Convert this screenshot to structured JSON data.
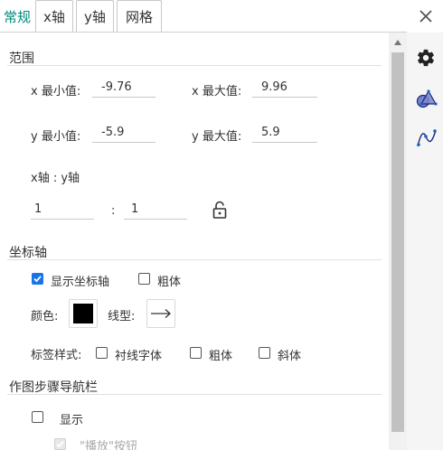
{
  "tabs": [
    {
      "label": "常规",
      "active": true
    },
    {
      "label": "x轴",
      "active": false
    },
    {
      "label": "y轴",
      "active": false
    },
    {
      "label": "网格",
      "active": false
    }
  ],
  "icons": {
    "close": "close-icon",
    "side": [
      "gear-icon",
      "graphics-shapes-icon",
      "function-graph-icon"
    ]
  },
  "range": {
    "title": "范围",
    "xmin_label": "x 最小值:",
    "xmin_value": "-9.76",
    "xmax_label": "x 最大值:",
    "xmax_value": "9.96",
    "ymin_label": "y 最小值:",
    "ymin_value": "-5.9",
    "ymax_label": "y 最大值:",
    "ymax_value": "5.9",
    "ratio_label": "x轴 : y轴",
    "ratio_x": "1",
    "ratio_sep": ":",
    "ratio_y": "1"
  },
  "axes": {
    "title": "坐标轴",
    "show_axes_label": "显示坐标轴",
    "show_axes_checked": true,
    "bold_label": "粗体",
    "bold_checked": false,
    "color_label": "颜色:",
    "color_value": "#000000",
    "linestyle_label": "线型:",
    "label_style_label": "标签样式:",
    "serif_label": "衬线字体",
    "label_bold_label": "粗体",
    "italic_label": "斜体"
  },
  "navbar": {
    "title": "作图步骤导航栏",
    "show_label": "显示",
    "show_checked": false,
    "play_label": "\"播放\"按钮"
  },
  "colors": {
    "accent": "#00897b",
    "checkbox": "#1a73e8",
    "icon_blue": "#1565c0"
  }
}
